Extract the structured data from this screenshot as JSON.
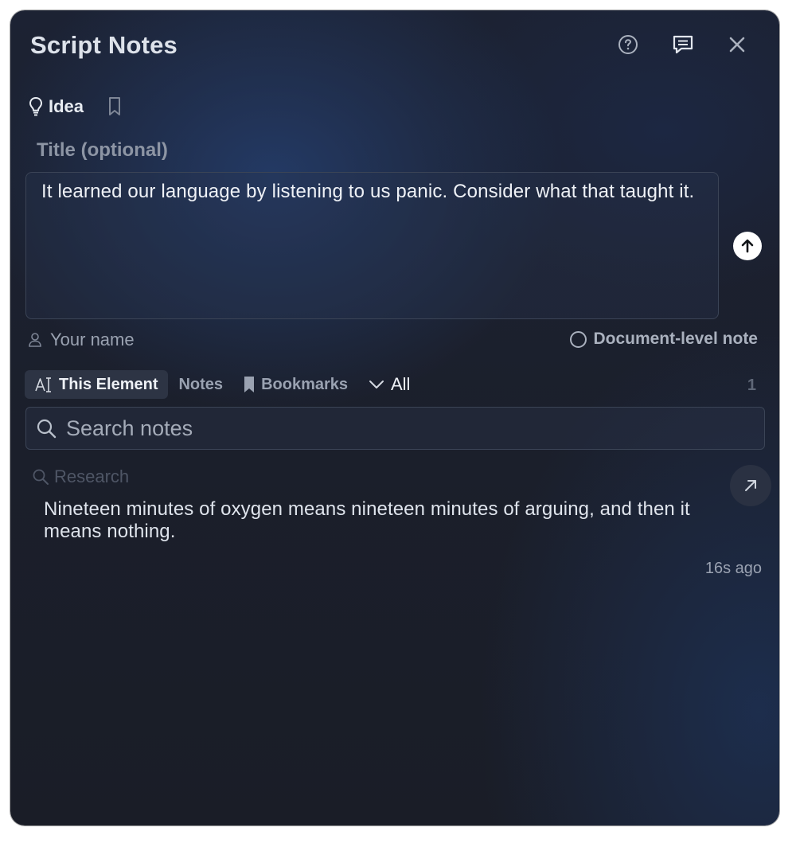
{
  "header": {
    "title": "Script Notes",
    "help_icon": "help-circle-icon",
    "comment_icon": "comment-icon",
    "close_icon": "close-icon"
  },
  "composer": {
    "type_label": "Idea",
    "type_icon": "lightbulb-icon",
    "bookmark_icon": "bookmark-outline-icon",
    "title_placeholder": "Title (optional)",
    "note_value": "It learned our language by listening to us panic. Consider what that taught it.",
    "send_icon": "arrow-up-icon",
    "name_placeholder": "Your name",
    "document_level_label": "Document-level note"
  },
  "filters": {
    "tabs": [
      {
        "label": "This Element",
        "icon": "text-cursor-icon",
        "active": true
      },
      {
        "label": "Notes",
        "active": false
      },
      {
        "label": "Bookmarks",
        "icon": "bookmark-icon",
        "active": false
      }
    ],
    "scope_label": "All",
    "count": "1"
  },
  "search": {
    "placeholder": "Search notes"
  },
  "notes": [
    {
      "category": "Research",
      "text": "Nineteen minutes of oxygen means nineteen minutes of arguing, and then it means nothing.",
      "time": "16s ago"
    }
  ],
  "colors": {
    "panel_bg": "#1b1f2b",
    "text_primary": "#eef1f6",
    "text_muted": "#9aa2b1",
    "border": "#3b4456"
  }
}
